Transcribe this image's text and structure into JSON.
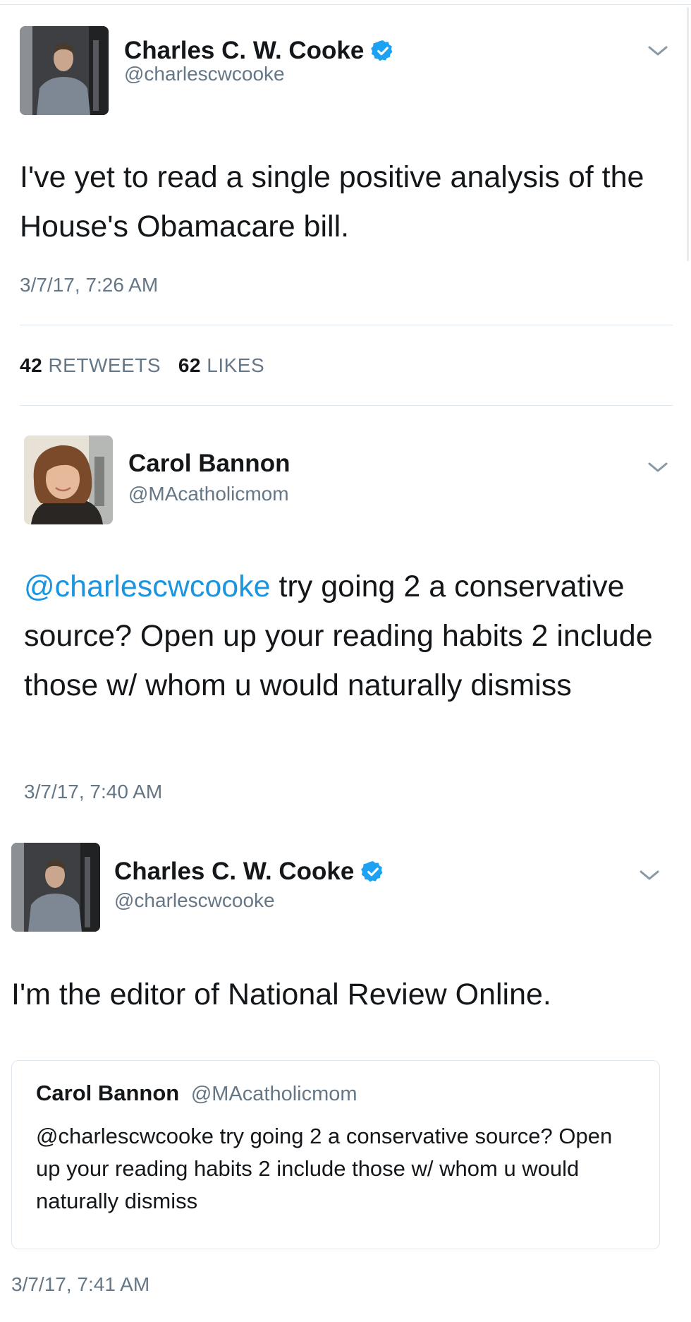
{
  "tweets": [
    {
      "name": "Charles C. W. Cooke",
      "handle": "@charlescwcooke",
      "verified": true,
      "text": "I've yet to read a single positive analysis of the House's Obamacare bill.",
      "time": "3/7/17, 7:26 AM",
      "retweets_count": "42",
      "retweets_label": "RETWEETS",
      "likes_count": "62",
      "likes_label": "LIKES"
    },
    {
      "name": "Carol Bannon",
      "handle": "@MAcatholicmom",
      "verified": false,
      "mention": "@charlescwcooke",
      "text": " try going 2 a conservative source? Open up your reading habits 2 include those w/ whom u would naturally dismiss",
      "time": "3/7/17, 7:40 AM"
    },
    {
      "name": "Charles C. W. Cooke",
      "handle": "@charlescwcooke",
      "verified": true,
      "text": "I'm the editor of National Review Online.",
      "quote": {
        "name": "Carol Bannon",
        "handle": "@MAcatholicmom",
        "text": "@charlescwcooke try going 2 a conservative source? Open up your reading habits 2 include those w/ whom u would naturally dismiss"
      },
      "time": "3/7/17, 7:41 AM"
    }
  ],
  "colors": {
    "link_blue": "#1b95e0",
    "verified_blue": "#1da1f2",
    "secondary_text": "#657786",
    "divider": "#e1e8ed"
  },
  "icons": {
    "verified": "verified-badge-icon",
    "menu": "chevron-down-icon"
  }
}
